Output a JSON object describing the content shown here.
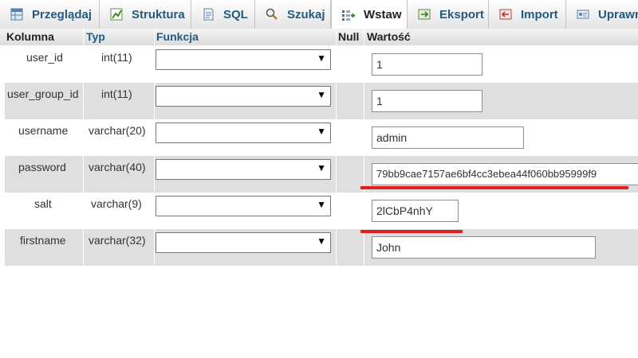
{
  "tabs": [
    {
      "label": "Przeglądaj",
      "icon": "browse-icon"
    },
    {
      "label": "Struktura",
      "icon": "structure-icon"
    },
    {
      "label": "SQL",
      "icon": "sql-icon"
    },
    {
      "label": "Szukaj",
      "icon": "search-icon"
    },
    {
      "label": "Wstaw",
      "icon": "insert-icon",
      "active": true
    },
    {
      "label": "Eksport",
      "icon": "export-icon"
    },
    {
      "label": "Import",
      "icon": "import-icon"
    },
    {
      "label": "Uprawn",
      "icon": "privileges-icon"
    }
  ],
  "columns": {
    "kolumna": "Kolumna",
    "typ": "Typ",
    "funkcja": "Funkcja",
    "null": "Null",
    "wartosc": "Wartość"
  },
  "rows": [
    {
      "column": "user_id",
      "type": "int(11)",
      "function": "",
      "value": "1"
    },
    {
      "column": "user_group_id",
      "type": "int(11)",
      "function": "",
      "value": "1"
    },
    {
      "column": "username",
      "type": "varchar(20)",
      "function": "",
      "value": "admin"
    },
    {
      "column": "password",
      "type": "varchar(40)",
      "function": "",
      "value": "79bb9cae7157ae6bf4cc3ebea44f060bb95999f9"
    },
    {
      "column": "salt",
      "type": "varchar(9)",
      "function": "",
      "value": "2lCbP4nhY"
    },
    {
      "column": "firstname",
      "type": "varchar(32)",
      "function": "",
      "value": "John"
    }
  ],
  "highlight_color": "#e02020",
  "link_color": "#235a81"
}
